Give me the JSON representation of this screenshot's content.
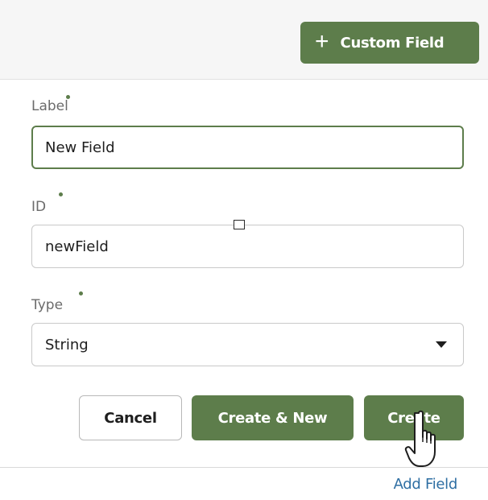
{
  "header": {
    "custom_field_button": {
      "icon": "plus-icon",
      "label": "Custom Field"
    }
  },
  "form": {
    "label_field": {
      "label": "Label",
      "value": "New Field",
      "required": true
    },
    "id_field": {
      "label": "ID",
      "value": "newField",
      "required": true
    },
    "type_field": {
      "label": "Type",
      "value": "String",
      "required": true,
      "icon": "chevron-down-icon"
    }
  },
  "actions": {
    "cancel": "Cancel",
    "create_new": "Create & New",
    "create": "Create"
  },
  "footer": {
    "add_field": "Add Field"
  },
  "colors": {
    "accent": "#5d7d4b",
    "link": "#2f6fa3"
  }
}
